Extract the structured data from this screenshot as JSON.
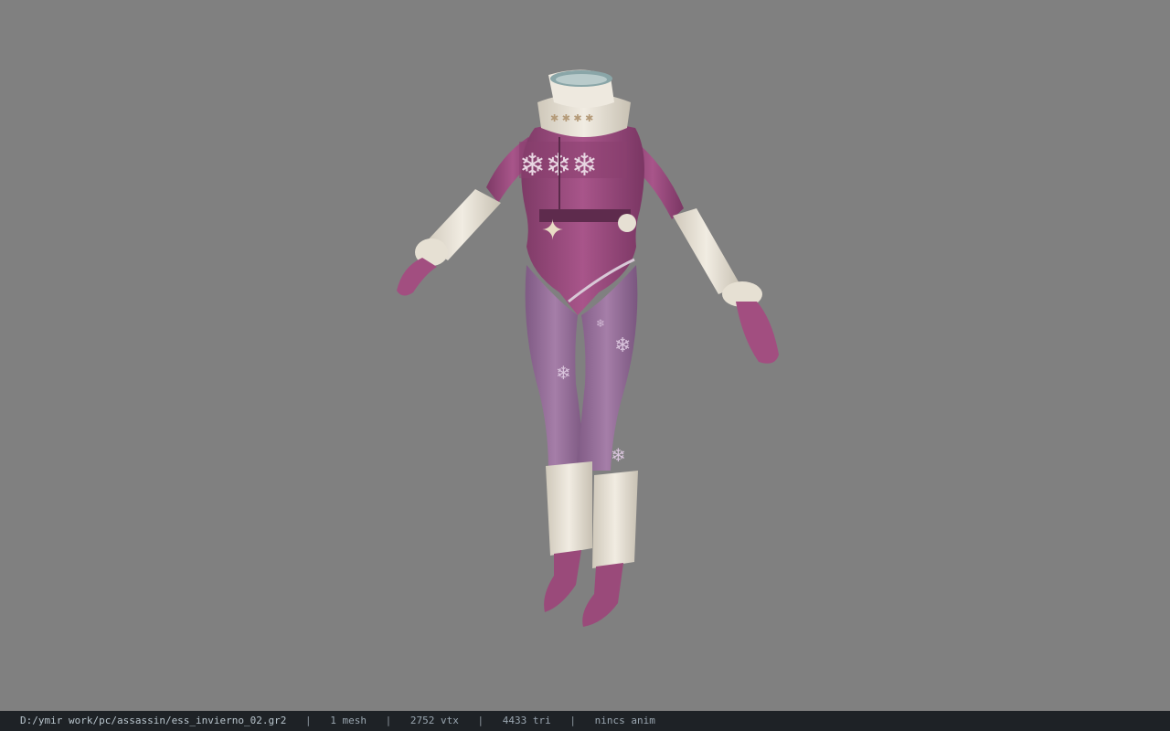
{
  "viewer": {
    "background_color": "#808080",
    "model_name": "ess_invierno_02"
  },
  "status_bar": {
    "file_path": "D:/ymir work/pc/assassin/ess_invierno_02.gr2",
    "mesh_count": "1 mesh",
    "vertex_count": "2752 vtx",
    "triangle_count": "4433 tri",
    "animation": "nincs anim",
    "separator": "|"
  },
  "colors": {
    "knit_purple": "#a0507f",
    "tights_purple": "#9b6f9e",
    "cream_white": "#e9e3d6",
    "statusbar_bg": "#1e2226"
  }
}
